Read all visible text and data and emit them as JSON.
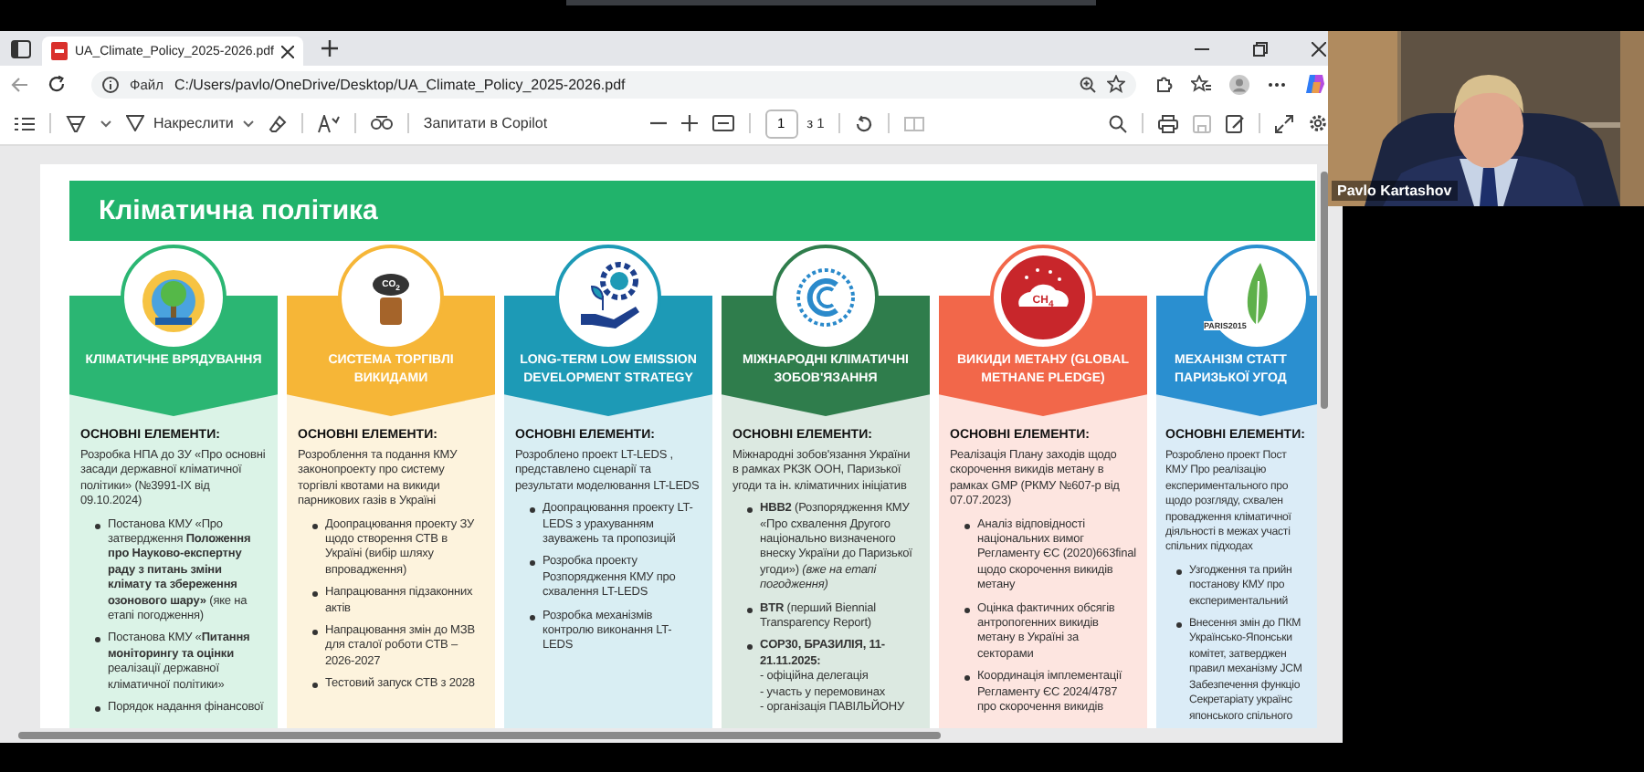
{
  "browser": {
    "tab": {
      "title": "UA_Climate_Policy_2025-2026.pdf",
      "selected": true
    },
    "address": {
      "scheme_label": "Файл",
      "url": "C:/Users/pavlo/OneDrive/Desktop/UA_Climate_Policy_2025-2026.pdf"
    },
    "pdf_toolbar": {
      "draw_label": "Накреслити",
      "copilot_label": "Запитати в Copilot",
      "page": "1",
      "page_total": "з 1"
    }
  },
  "page": {
    "title": "Кліматична політика",
    "columns": [
      {
        "title": "КЛІМАТИЧНЕ ВРЯДУВАННЯ",
        "color": "#2bb673",
        "icon": {
          "kind": "climate"
        },
        "heading": "ОСНОВНІ ЕЛЕМЕНТИ:",
        "intro": "Розробка НПА до ЗУ «Про основні засади державної кліматичної політики» (№3991-IX від 09.10.2024)",
        "bullets": [
          "Постанова КМУ «Про затвердження **Положення про Науково-експертну раду з питань зміни клімату та збереження озонового шару»** (яке на етапі погодження)",
          "Постанова КМУ «**Питання моніторингу та оцінки** реалізації державної кліматичної політики»",
          "Порядок надання фінансової"
        ]
      },
      {
        "title": "СИСТЕМА ТОРГІВЛІ ВИКИДАМИ",
        "color": "#f6b637",
        "icon": {
          "kind": "co2",
          "label": "CO$_{2}$"
        },
        "heading": "ОСНОВНІ ЕЛЕМЕНТИ:",
        "intro": "Розроблення та подання КМУ законопроекту про систему торгівлі квотами на викиди парникових газів в Україні",
        "bullets": [
          "Доопрацювання проекту ЗУ щодо створення СТВ в Україні (вибір шляху впровадження)",
          "Напрацювання підзаконних актів",
          "Напрацювання змін до МЗВ для сталої роботи СТВ – 2026-2027",
          "Тестовий запуск СТВ з 2028"
        ]
      },
      {
        "title": "LONG-TERM LOW EMISSION DEVELOPMENT STRATEGY",
        "color": "#1d9ab6",
        "icon": {
          "kind": "growth"
        },
        "heading": "ОСНОВНІ ЕЛЕМЕНТИ:",
        "intro": "Розроблено проект LT-LEDS , представлено сценарії та результати моделювання LT-LEDS",
        "bullets": [
          "Доопрацювання проекту LT-LEDS з урахуванням зауважень та пропозицій",
          "Розробка проекту Розпорядження КМУ про схвалення LT-LEDS",
          "Розробка механізмів контролю виконання LT-LEDS"
        ]
      },
      {
        "title": "МІЖНАРОДНІ КЛІМАТИЧНІ ЗОБОВ'ЯЗАННЯ",
        "color": "#2f7d4c",
        "icon": {
          "kind": "wreath"
        },
        "heading": "ОСНОВНІ ЕЛЕМЕНТИ:",
        "intro": "Міжнародні зобов'язання України в рамках РКЗК ООН, Паризької угоди та ін. кліматичних ініціатив",
        "bullets": [
          "**НВВ2** (Розпорядження КМУ «Про схвалення Другого національно визначеного внеску України до Паризької угоди») *(вже на етапі погодження)*",
          "**BTR** (перший Biennial Transparency Report)",
          "**COP30, БРАЗИЛІЯ, 11-21.11.2025:**\n- офіційна делегація\n- участь у перемовинах\n- організація ПАВІЛЬЙОНУ"
        ]
      },
      {
        "title": "ВИКИДИ МЕТАНУ (GLOBAL METHANE PLEDGE)",
        "color": "#f2674a",
        "icon": {
          "kind": "ch4",
          "label": "CH$_{4}$"
        },
        "heading": "ОСНОВНІ ЕЛЕМЕНТИ:",
        "intro": "Реалізація Плану заходів щодо скорочення викидів метану в рамках GMP (РКМУ №607-р від 07.07.2023)",
        "bullets": [
          "Аналіз відповідності національних вимог Регламенту ЄС (2020)663final щодо скорочення викидів метану",
          "Оцінка фактичних обсягів антропогенних викидів метану в Україні за секторами",
          "Координація імплементації Регламенту ЄС 2024/4787 про скорочення викидів"
        ]
      },
      {
        "title": "МЕХАНІЗМ СТАТТ\nПАРИЗЬКОЇ УГОД",
        "color": "#2a8fd0",
        "icon": {
          "kind": "leaf",
          "label": "PARIS2015"
        },
        "heading": "ОСНОВНІ ЕЛЕМЕНТИ:",
        "intro": "Розроблено проект Пост\nКМУ Про реалізацію\nекспериментального про\nщодо розгляду, схвален\nпровадження кліматичної\nдіяльності в межах участі\nспільних підходах",
        "bullets": [
          "Узгодження та прийн\nпостанову КМУ про\nекспериментальний",
          "Внесення змін до ПКМ\nУкраїнсько-Японськи\nкомітет,  затверджен\nправил механізму JCM\nЗабезпечення  функціо\nСекретаріату українс\nяпонського спільного"
        ]
      }
    ]
  },
  "video": {
    "name": "Pavlo Kartashov"
  }
}
